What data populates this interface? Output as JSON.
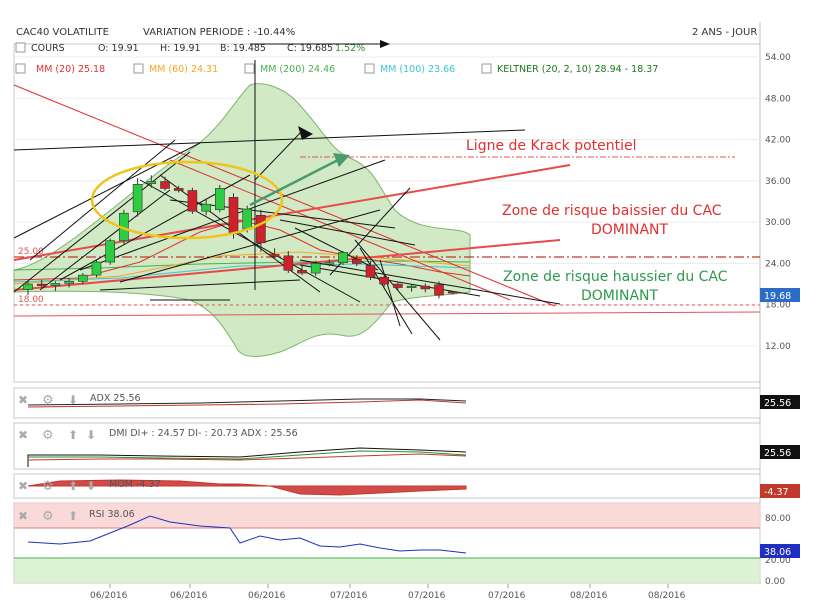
{
  "header": {
    "symbol": "CAC40 VOLATILITE",
    "variation": "VARIATION PERIODE : -10.44%",
    "period": "2 ANS - JOUR"
  },
  "ohlc": {
    "label": "COURS",
    "o": "O: 19.91",
    "h": "H: 19.91",
    "b": "B: 19.485",
    "c": "C: 19.685",
    "chg": "1.52%"
  },
  "indicators": [
    {
      "label": "MM (20)",
      "value": "25.18",
      "color": "#e03030"
    },
    {
      "label": "MM (60)",
      "value": "24.31",
      "color": "#f5a623"
    },
    {
      "label": "MM (200)",
      "value": "24.46",
      "color": "#4caf50"
    },
    {
      "label": "MM (100)",
      "value": "23.66",
      "color": "#3fc3d8"
    },
    {
      "label": "KELTNER (20, 2, 10)",
      "value": "28.94 - 18.37",
      "color": "#1a7a1a"
    }
  ],
  "annotations": {
    "krack": "Ligne de Krack potentiel",
    "baissier1": "Zone de risque baissier du CAC",
    "baissier2": "DOMINANT",
    "haussier1": "Zone de risque haussier du CAC",
    "haussier2": "DOMINANT",
    "level25": "25.00",
    "level18": "18.00"
  },
  "last_price": "19.68",
  "panels": {
    "adx": {
      "label": "ADX",
      "value": "25.56",
      "tag": "25.56"
    },
    "dmi": {
      "label": "DMI",
      "text": "DI+ : 24.57 DI- : 20.73 ADX : 25.56",
      "tag": "25.56"
    },
    "mom": {
      "label": "MOM",
      "value": "-4.37",
      "tag": "-4.37"
    },
    "rsi": {
      "label": "RSI",
      "value": "38.06",
      "tag": "38.06",
      "ticks": [
        "80.00",
        "20.00",
        "0.00"
      ]
    }
  },
  "chart_data": {
    "type": "candlestick",
    "y_ticks": [
      "54.00",
      "48.00",
      "42.00",
      "36.00",
      "30.00",
      "24.00",
      "18.00",
      "12.00"
    ],
    "x_ticks": [
      "06/2016",
      "06/2016",
      "06/2016",
      "07/2016",
      "07/2016",
      "07/2016",
      "08/2016",
      "08/2016"
    ],
    "ylim": [
      8,
      56
    ],
    "candles": [
      {
        "o": 20.2,
        "h": 21.5,
        "l": 19.4,
        "c": 21.0
      },
      {
        "o": 21.0,
        "h": 21.6,
        "l": 20.3,
        "c": 20.8
      },
      {
        "o": 20.8,
        "h": 21.4,
        "l": 20.0,
        "c": 21.1
      },
      {
        "o": 21.1,
        "h": 21.9,
        "l": 20.5,
        "c": 21.4
      },
      {
        "o": 21.4,
        "h": 22.6,
        "l": 21.0,
        "c": 22.3
      },
      {
        "o": 22.3,
        "h": 24.6,
        "l": 22.0,
        "c": 24.2
      },
      {
        "o": 24.2,
        "h": 27.6,
        "l": 23.8,
        "c": 27.3
      },
      {
        "o": 27.3,
        "h": 31.8,
        "l": 26.8,
        "c": 31.3
      },
      {
        "o": 31.5,
        "h": 36.4,
        "l": 30.8,
        "c": 35.5
      },
      {
        "o": 35.6,
        "h": 36.8,
        "l": 35.0,
        "c": 35.9
      },
      {
        "o": 35.9,
        "h": 36.6,
        "l": 34.6,
        "c": 34.9
      },
      {
        "o": 34.9,
        "h": 35.3,
        "l": 34.3,
        "c": 34.6
      },
      {
        "o": 34.6,
        "h": 35.0,
        "l": 31.2,
        "c": 31.6
      },
      {
        "o": 31.6,
        "h": 33.4,
        "l": 31.0,
        "c": 32.6
      },
      {
        "o": 31.8,
        "h": 35.4,
        "l": 31.4,
        "c": 34.9
      },
      {
        "o": 33.6,
        "h": 34.2,
        "l": 27.6,
        "c": 28.3
      },
      {
        "o": 29.0,
        "h": 32.4,
        "l": 28.5,
        "c": 31.9
      },
      {
        "o": 31.0,
        "h": 31.8,
        "l": 25.7,
        "c": 27.0
      },
      {
        "o": 25.3,
        "h": 26.2,
        "l": 24.8,
        "c": 25.0
      },
      {
        "o": 25.1,
        "h": 25.8,
        "l": 22.6,
        "c": 23.0
      },
      {
        "o": 23.0,
        "h": 23.7,
        "l": 22.3,
        "c": 22.6
      },
      {
        "o": 22.6,
        "h": 24.4,
        "l": 22.2,
        "c": 24.0
      },
      {
        "o": 24.0,
        "h": 24.6,
        "l": 23.6,
        "c": 24.1
      },
      {
        "o": 24.1,
        "h": 25.8,
        "l": 23.8,
        "c": 25.6
      },
      {
        "o": 24.6,
        "h": 25.2,
        "l": 23.6,
        "c": 24.0
      },
      {
        "o": 23.7,
        "h": 24.3,
        "l": 21.6,
        "c": 22.0
      },
      {
        "o": 22.0,
        "h": 22.6,
        "l": 20.6,
        "c": 21.0
      },
      {
        "o": 21.0,
        "h": 21.3,
        "l": 20.0,
        "c": 20.5
      },
      {
        "o": 20.5,
        "h": 21.0,
        "l": 19.9,
        "c": 20.7
      },
      {
        "o": 20.7,
        "h": 21.1,
        "l": 19.8,
        "c": 20.3
      },
      {
        "o": 20.9,
        "h": 21.4,
        "l": 18.9,
        "c": 19.4
      },
      {
        "o": 19.9,
        "h": 19.9,
        "l": 19.5,
        "c": 19.7
      }
    ]
  }
}
